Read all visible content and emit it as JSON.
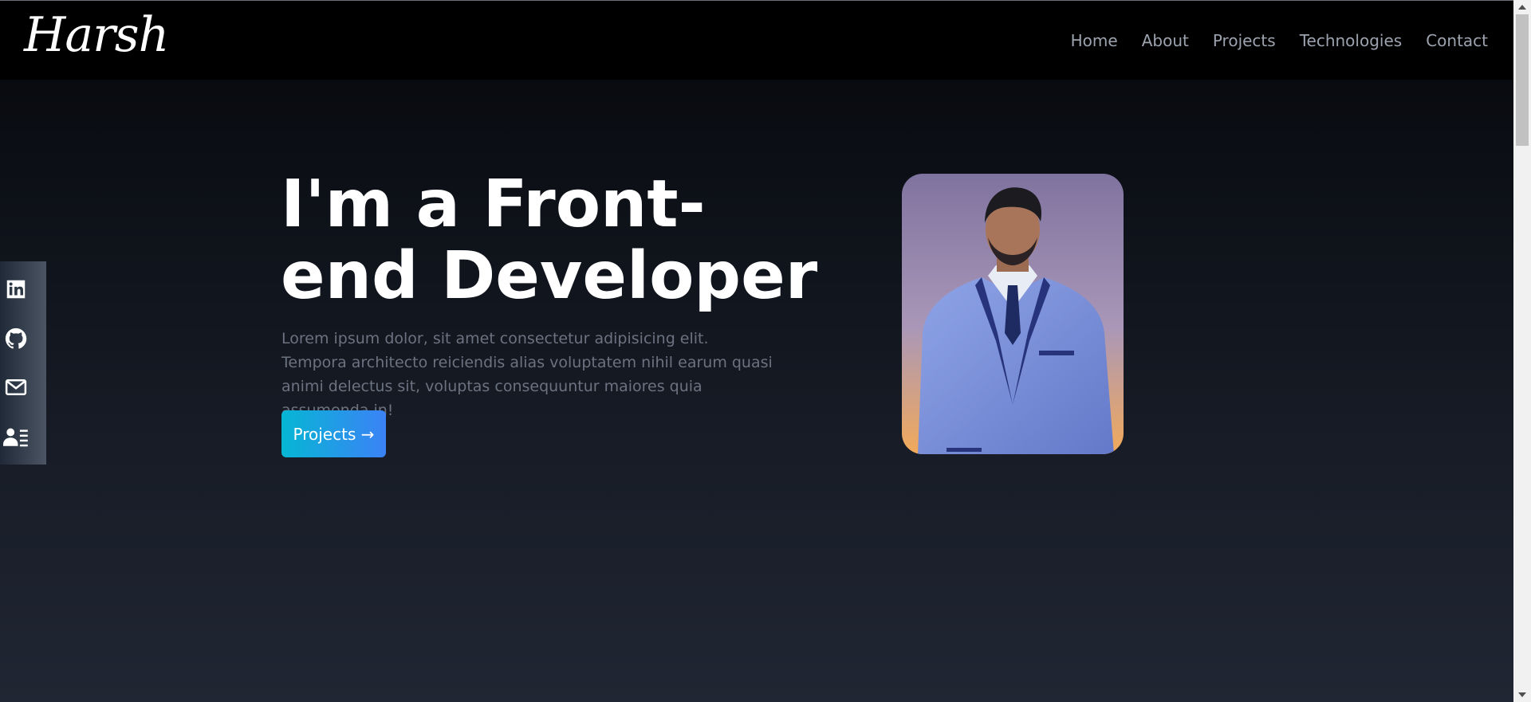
{
  "nav": {
    "logo": "Harsh",
    "links": [
      "Home",
      "About",
      "Projects",
      "Technologies",
      "Contact"
    ]
  },
  "hero": {
    "title_line1": "I'm a Front-",
    "title_line2": "end Developer",
    "description": "Lorem ipsum dolor, sit amet consectetur adipisicing elit. Tempora architecto reiciendis alias voluptatem nihil earum quasi animi delectus sit, voluptas consequuntur maiores quia assumenda in!",
    "button_label": "Projects →"
  },
  "social": {
    "icons": [
      "linkedin-icon",
      "github-icon",
      "mail-icon",
      "resume-icon"
    ]
  },
  "colors": {
    "navbar_bg": "#000000",
    "nav_link": "#9ca3af",
    "button_gradient_start": "#06b6d4",
    "button_gradient_end": "#3b82f6",
    "description_text": "#6b7280"
  }
}
